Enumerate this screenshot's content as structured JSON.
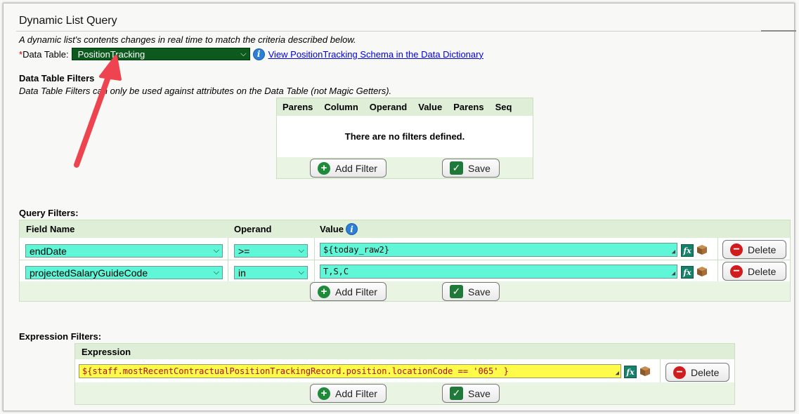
{
  "header": {
    "title": "Dynamic List Query",
    "description": "A dynamic list's contents changes in real time to match the criteria described below."
  },
  "data_table": {
    "required_mark": "*",
    "label": "Data Table:",
    "selected": "PositionTracking",
    "schema_link": "View PositionTracking Schema in the Data Dictionary"
  },
  "data_table_filters": {
    "label": "Data Table Filters",
    "note": "Data Table Filters can only be used against attributes on the Data Table (not Magic Getters).",
    "columns": [
      "Parens",
      "Column",
      "Operand",
      "Value",
      "Parens",
      "Seq"
    ],
    "empty_message": "There are no filters defined.",
    "add_label": "Add Filter",
    "save_label": "Save"
  },
  "query_filters": {
    "label": "Query Filters:",
    "columns": {
      "field": "Field Name",
      "operand": "Operand",
      "value": "Value"
    },
    "rows": [
      {
        "field": "endDate",
        "operand": ">=",
        "value": "${today_raw2}",
        "delete_label": "Delete"
      },
      {
        "field": "projectedSalaryGuideCode",
        "operand": "in",
        "value": "T,S,C",
        "delete_label": "Delete"
      }
    ],
    "add_label": "Add Filter",
    "save_label": "Save"
  },
  "expression_filters": {
    "label": "Expression Filters:",
    "column": "Expression",
    "rows": [
      {
        "expression": "${staff.mostRecentContractualPositionTrackingRecord.position.locationCode == '065' }",
        "delete_label": "Delete"
      }
    ],
    "add_label": "Add Filter",
    "save_label": "Save"
  },
  "icons": {
    "info": "info-icon",
    "fx": "fx-icon",
    "box": "box-icon",
    "plus": "plus-icon",
    "check": "check-icon",
    "minus": "minus-icon",
    "chevron": "chevron-down-icon",
    "arrow": "annotation-arrow"
  },
  "colors": {
    "data_table_select": "#0c5a1e",
    "field_highlight": "#5ff7d8",
    "expression_highlight": "#fffb4a",
    "table_header": "#dfeed6",
    "annotation_arrow": "#ee4450"
  }
}
